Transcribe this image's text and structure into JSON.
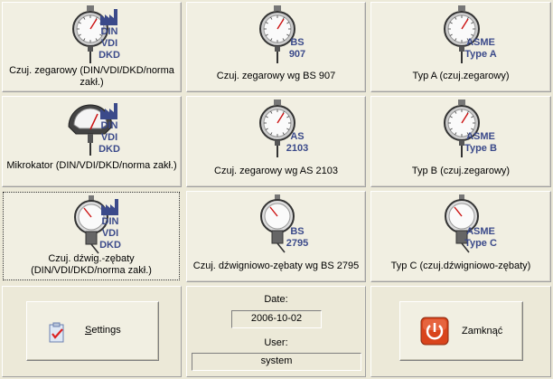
{
  "tiles": [
    {
      "caption": "Czuj. zegarowy (DIN/VDI/DKD/norma zakł.)",
      "std": [
        "DIN",
        "VDI",
        "DKD"
      ],
      "icon": "dial-indicator-icon",
      "factory": true
    },
    {
      "caption": "Czuj. zegarowy wg BS 907",
      "std": [
        "BS",
        "907"
      ],
      "icon": "dial-indicator-icon",
      "factory": false
    },
    {
      "caption": "Typ A (czuj.zegarowy)",
      "std": [
        "ASME",
        "Type A"
      ],
      "icon": "dial-indicator-icon",
      "factory": false
    },
    {
      "caption": "Mikrokator (DIN/VDI/DKD/norma zakł.)",
      "std": [
        "DIN",
        "VDI",
        "DKD"
      ],
      "icon": "mikrokator-icon",
      "factory": true
    },
    {
      "caption": "Czuj. zegarowy wg AS 2103",
      "std": [
        "AS",
        "2103"
      ],
      "icon": "dial-indicator-icon",
      "factory": false
    },
    {
      "caption": "Typ B (czuj.zegarowy)",
      "std": [
        "ASME",
        "Type B"
      ],
      "icon": "dial-indicator-icon",
      "factory": false
    },
    {
      "caption": "Czuj. dźwig.-zębaty\n(DIN/VDI/DKD/norma zakł.)",
      "std": [
        "DIN",
        "VDI",
        "DKD"
      ],
      "icon": "lever-indicator-icon",
      "factory": true
    },
    {
      "caption": "Czuj. dźwigniowo-zębaty wg BS 2795",
      "std": [
        "BS",
        "2795"
      ],
      "icon": "lever-indicator-icon",
      "factory": false
    },
    {
      "caption": "Typ C (czuj.dźwigniowo-zębaty)",
      "std": [
        "ASME",
        "Type C"
      ],
      "icon": "lever-indicator-icon",
      "factory": false
    }
  ],
  "settings_button": {
    "label_accel": "S",
    "label_rest": "ettings",
    "icon": "settings-clipboard-icon"
  },
  "info": {
    "date_label": "Date:",
    "date_value": "2006-10-02",
    "user_label": "User:",
    "user_value": "system"
  },
  "close_button": {
    "label": "Zamknąć",
    "icon": "power-icon"
  },
  "colors": {
    "standard_text": "#3b4a8a",
    "close_icon": "#d9441c"
  }
}
